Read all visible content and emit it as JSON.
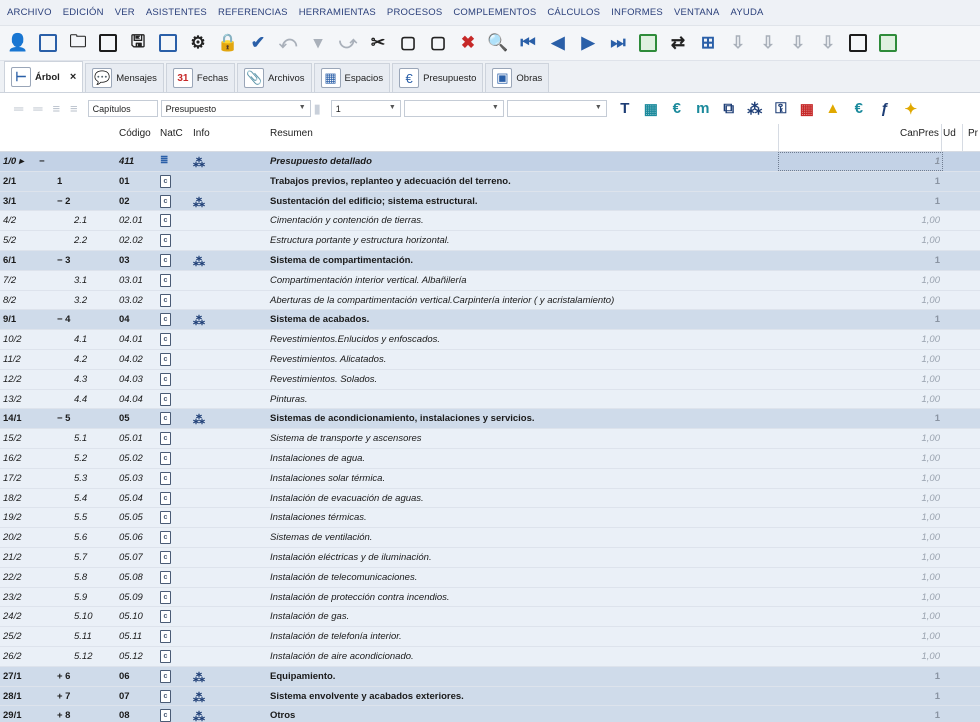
{
  "menu": [
    "ARCHIVO",
    "EDICIÓN",
    "VER",
    "ASISTENTES",
    "REFERENCIAS",
    "HERRAMIENTAS",
    "PROCESOS",
    "COMPLEMENTOS",
    "CÁLCULOS",
    "INFORMES",
    "VENTANA",
    "AYUDA"
  ],
  "tabs": [
    {
      "label": "Árbol",
      "icon": "tree-icon",
      "active": true,
      "close": "×"
    },
    {
      "label": "Mensajes",
      "icon": "speech-bubble-icon"
    },
    {
      "label": "Fechas",
      "icon": "calendar-icon",
      "icon_text": "31"
    },
    {
      "label": "Archivos",
      "icon": "paperclip-icon"
    },
    {
      "label": "Espacios",
      "icon": "spaces-icon"
    },
    {
      "label": "Presupuesto",
      "icon": "budget-icon"
    },
    {
      "label": "Obras",
      "icon": "works-icon"
    }
  ],
  "toolbar2": {
    "level_select": "Capítulos",
    "view_select": "Presupuesto",
    "number_select": "1",
    "combo_empty_1": "",
    "combo_empty_2": ""
  },
  "columns": {
    "codigo": "Código",
    "natc": "NatC",
    "info": "Info",
    "resumen": "Resumen",
    "canpres": "CanPres",
    "ud": "Ud",
    "pr": "Pr"
  },
  "rows": [
    {
      "idx": "1/0 ▸",
      "ch": "−",
      "cod": "411",
      "nat": "sort",
      "info": true,
      "res": "Presupuesto detallado",
      "can": "1",
      "level": 0
    },
    {
      "idx": "2/1",
      "ch": "1",
      "cod": "01",
      "nat": "doc",
      "info": false,
      "res": "Trabajos previos, replanteo y adecuación del terreno.",
      "can": "1",
      "level": 1
    },
    {
      "idx": "3/1",
      "ch": "− 2",
      "cod": "02",
      "nat": "doc",
      "info": true,
      "res": "Sustentación del edificio; sistema estructural.",
      "can": "1",
      "level": 1
    },
    {
      "idx": "4/2",
      "ch": "2.1",
      "cod": "02.01",
      "nat": "doc",
      "info": false,
      "res": "Cimentación y contención de tierras.",
      "can": "1,00",
      "level": 2
    },
    {
      "idx": "5/2",
      "ch": "2.2",
      "cod": "02.02",
      "nat": "doc",
      "info": false,
      "res": "Estructura portante y estructura horizontal.",
      "can": "1,00",
      "level": 2
    },
    {
      "idx": "6/1",
      "ch": "− 3",
      "cod": "03",
      "nat": "doc",
      "info": true,
      "res": "Sistema de compartimentación.",
      "can": "1",
      "level": 1
    },
    {
      "idx": "7/2",
      "ch": "3.1",
      "cod": "03.01",
      "nat": "doc",
      "info": false,
      "res": "Compartimentación interior vertical. Albañilería",
      "can": "1,00",
      "level": 2
    },
    {
      "idx": "8/2",
      "ch": "3.2",
      "cod": "03.02",
      "nat": "doc",
      "info": false,
      "res": "Aberturas de la compartimentación vertical.Carpintería interior ( y acristalamiento)",
      "can": "1,00",
      "level": 2
    },
    {
      "idx": "9/1",
      "ch": "− 4",
      "cod": "04",
      "nat": "doc",
      "info": true,
      "res": "Sistema de acabados.",
      "can": "1",
      "level": 1
    },
    {
      "idx": "10/2",
      "ch": "4.1",
      "cod": "04.01",
      "nat": "doc",
      "info": false,
      "res": "Revestimientos.Enlucidos y enfoscados.",
      "can": "1,00",
      "level": 2
    },
    {
      "idx": "11/2",
      "ch": "4.2",
      "cod": "04.02",
      "nat": "doc",
      "info": false,
      "res": "Revestimientos. Alicatados.",
      "can": "1,00",
      "level": 2
    },
    {
      "idx": "12/2",
      "ch": "4.3",
      "cod": "04.03",
      "nat": "doc",
      "info": false,
      "res": "Revestimientos. Solados.",
      "can": "1,00",
      "level": 2
    },
    {
      "idx": "13/2",
      "ch": "4.4",
      "cod": "04.04",
      "nat": "doc",
      "info": false,
      "res": "Pinturas.",
      "can": "1,00",
      "level": 2
    },
    {
      "idx": "14/1",
      "ch": "− 5",
      "cod": "05",
      "nat": "doc",
      "info": true,
      "res": "Sistemas de acondicionamiento, instalaciones y servicios.",
      "can": "1",
      "level": 1
    },
    {
      "idx": "15/2",
      "ch": "5.1",
      "cod": "05.01",
      "nat": "doc",
      "info": false,
      "res": "Sistema de transporte y ascensores",
      "can": "1,00",
      "level": 2
    },
    {
      "idx": "16/2",
      "ch": "5.2",
      "cod": "05.02",
      "nat": "doc",
      "info": false,
      "res": "Instalaciones de agua.",
      "can": "1,00",
      "level": 2
    },
    {
      "idx": "17/2",
      "ch": "5.3",
      "cod": "05.03",
      "nat": "doc",
      "info": false,
      "res": "Instalaciones solar térmica.",
      "can": "1,00",
      "level": 2
    },
    {
      "idx": "18/2",
      "ch": "5.4",
      "cod": "05.04",
      "nat": "doc",
      "info": false,
      "res": "Instalación de evacuación de aguas.",
      "can": "1,00",
      "level": 2
    },
    {
      "idx": "19/2",
      "ch": "5.5",
      "cod": "05.05",
      "nat": "doc",
      "info": false,
      "res": "Instalaciones térmicas.",
      "can": "1,00",
      "level": 2
    },
    {
      "idx": "20/2",
      "ch": "5.6",
      "cod": "05.06",
      "nat": "doc",
      "info": false,
      "res": "Sistemas de ventilación.",
      "can": "1,00",
      "level": 2
    },
    {
      "idx": "21/2",
      "ch": "5.7",
      "cod": "05.07",
      "nat": "doc",
      "info": false,
      "res": "Instalación eléctricas y de iluminación.",
      "can": "1,00",
      "level": 2
    },
    {
      "idx": "22/2",
      "ch": "5.8",
      "cod": "05.08",
      "nat": "doc",
      "info": false,
      "res": "Instalación de telecomunicaciones.",
      "can": "1,00",
      "level": 2
    },
    {
      "idx": "23/2",
      "ch": "5.9",
      "cod": "05.09",
      "nat": "doc",
      "info": false,
      "res": "Instalación de protección contra incendios.",
      "can": "1,00",
      "level": 2
    },
    {
      "idx": "24/2",
      "ch": "5.10",
      "cod": "05.10",
      "nat": "doc",
      "info": false,
      "res": "Instalación de gas.",
      "can": "1,00",
      "level": 2
    },
    {
      "idx": "25/2",
      "ch": "5.11",
      "cod": "05.11",
      "nat": "doc",
      "info": false,
      "res": "Instalación de telefonía interior.",
      "can": "1,00",
      "level": 2
    },
    {
      "idx": "26/2",
      "ch": "5.12",
      "cod": "05.12",
      "nat": "doc",
      "info": false,
      "res": "Instalación de aire acondicionado.",
      "can": "1,00",
      "level": 2
    },
    {
      "idx": "27/1",
      "ch": "+ 6",
      "cod": "06",
      "nat": "doc",
      "info": true,
      "res": "Equipamiento.",
      "can": "1",
      "level": 1
    },
    {
      "idx": "28/1",
      "ch": "+ 7",
      "cod": "07",
      "nat": "doc",
      "info": true,
      "res": "Sistema envolvente y acabados exteriores.",
      "can": "1",
      "level": 1
    },
    {
      "idx": "29/1",
      "ch": "+ 8",
      "cod": "08",
      "nat": "doc",
      "info": true,
      "res": "Otros",
      "can": "1",
      "level": 1
    }
  ],
  "natc_doc_glyph": "c",
  "icons": {
    "sort": "≣",
    "info": "⁂"
  }
}
